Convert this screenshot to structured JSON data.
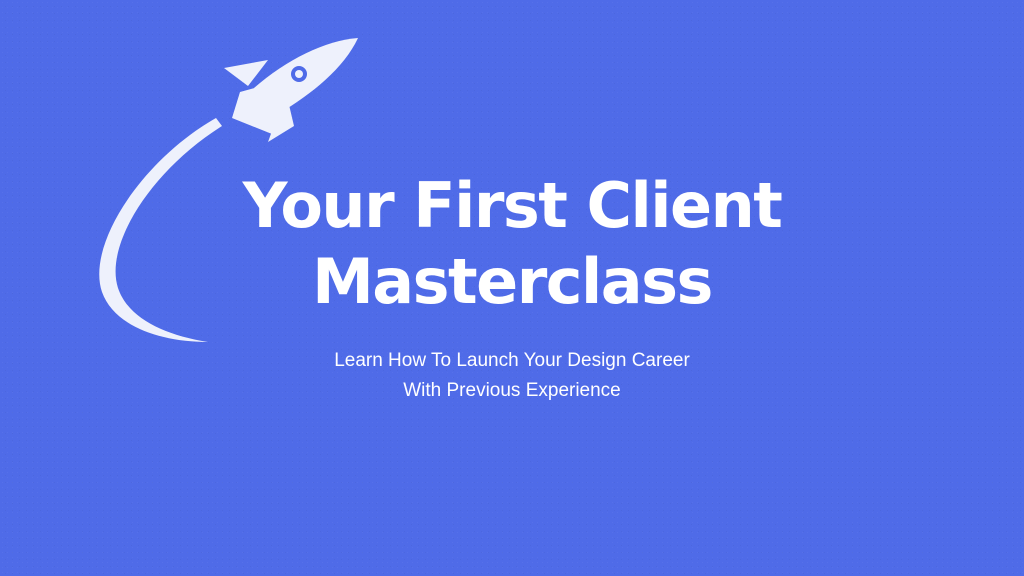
{
  "colors": {
    "background": "#4f6be8",
    "foreground": "#ffffff",
    "rocket": "#eef1fc"
  },
  "graphic": {
    "icon": "rocket-icon",
    "trail": "swoosh-trail"
  },
  "title": {
    "line1": "Your First Client",
    "line2": "Masterclass"
  },
  "subtitle": {
    "line1": "Learn How To Launch Your Design Career",
    "line2": "With Previous Experience"
  }
}
